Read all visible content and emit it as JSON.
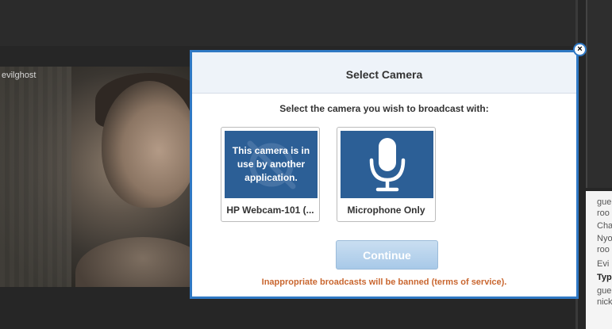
{
  "background": {
    "username": "evilghost",
    "right_panel_lines": [
      "gue",
      "roo",
      "Cha",
      "Nyo",
      "roo",
      "Evi",
      "Typ",
      "gue",
      "nick"
    ]
  },
  "modal": {
    "title": "Select Camera",
    "close_icon": "×",
    "instruction": "Select the camera you wish to broadcast with:",
    "cameras": [
      {
        "message": "This camera is in use by another application.",
        "label": "HP Webcam-101 (...",
        "icon": "camera-off-icon"
      },
      {
        "message": "",
        "label": "Microphone Only",
        "icon": "microphone-icon"
      }
    ],
    "continue_label": "Continue",
    "footer_prefix": "Inappropriate broadcasts will be banned (",
    "footer_link": "terms of service",
    "footer_suffix": ")."
  },
  "colors": {
    "modal_border": "#2f78c4",
    "thumb_bg": "#2c5f96",
    "warning_text": "#c9662f",
    "continue_bg": "#b5d1ec"
  }
}
